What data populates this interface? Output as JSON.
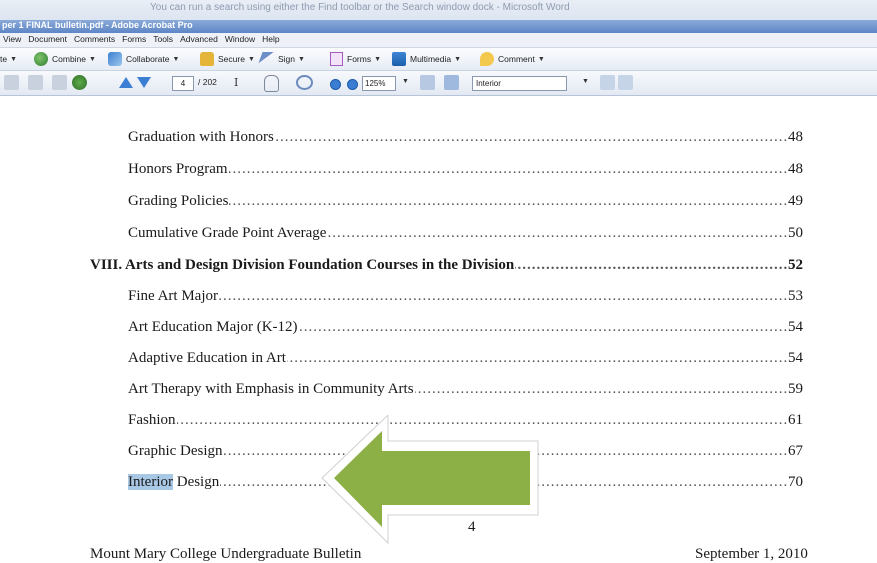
{
  "ghost_title": "You can run a search using either the Find toolbar or the Search window dock - Microsoft Word",
  "window_title": "per 1 FINAL bulletin.pdf - Adobe Acrobat Pro",
  "menu": [
    "View",
    "Document",
    "Comments",
    "Forms",
    "Tools",
    "Advanced",
    "Window",
    "Help"
  ],
  "tasks": {
    "create": "te",
    "combine": "Combine",
    "collaborate": "Collaborate",
    "secure": "Secure",
    "sign": "Sign",
    "forms": "Forms",
    "multimedia": "Multimedia",
    "comment": "Comment"
  },
  "nav": {
    "page_current": "4",
    "page_total": "/ 202",
    "zoom": "125%",
    "find_value": "Interior",
    "select_tool": "I"
  },
  "toc": [
    {
      "label": "Graduation with Honors",
      "page": "48"
    },
    {
      "label": "Honors Program",
      "page": "48"
    },
    {
      "label": "Grading Policies",
      "page": "49"
    },
    {
      "label": "Cumulative Grade Point Average",
      "page": "50"
    },
    {
      "label": "VIII. Arts and Design Division Foundation Courses in the Division",
      "page": "52"
    },
    {
      "label": "Fine Art Major",
      "page": "53"
    },
    {
      "label": "Art Education Major (K-12)",
      "page": "54"
    },
    {
      "label": "Adaptive Education in Art",
      "page": "54"
    },
    {
      "label": "Art Therapy with Emphasis in Community Arts",
      "page": "59"
    },
    {
      "label": "Fashion",
      "page": "61"
    },
    {
      "label": "Graphic Design",
      "page": "67"
    },
    {
      "label_highlight": "Interior",
      "label_rest": " Design",
      "page": "70"
    }
  ],
  "dots": "..................................................................................................................................................................................",
  "footer": {
    "page_number": "4",
    "title": "Mount Mary College Undergraduate Bulletin",
    "date": "September 1, 2010"
  },
  "colors": {
    "highlight": "#a9c8e6",
    "arrow_fill": "#8db046",
    "arrow_outline": "#ffffff"
  }
}
